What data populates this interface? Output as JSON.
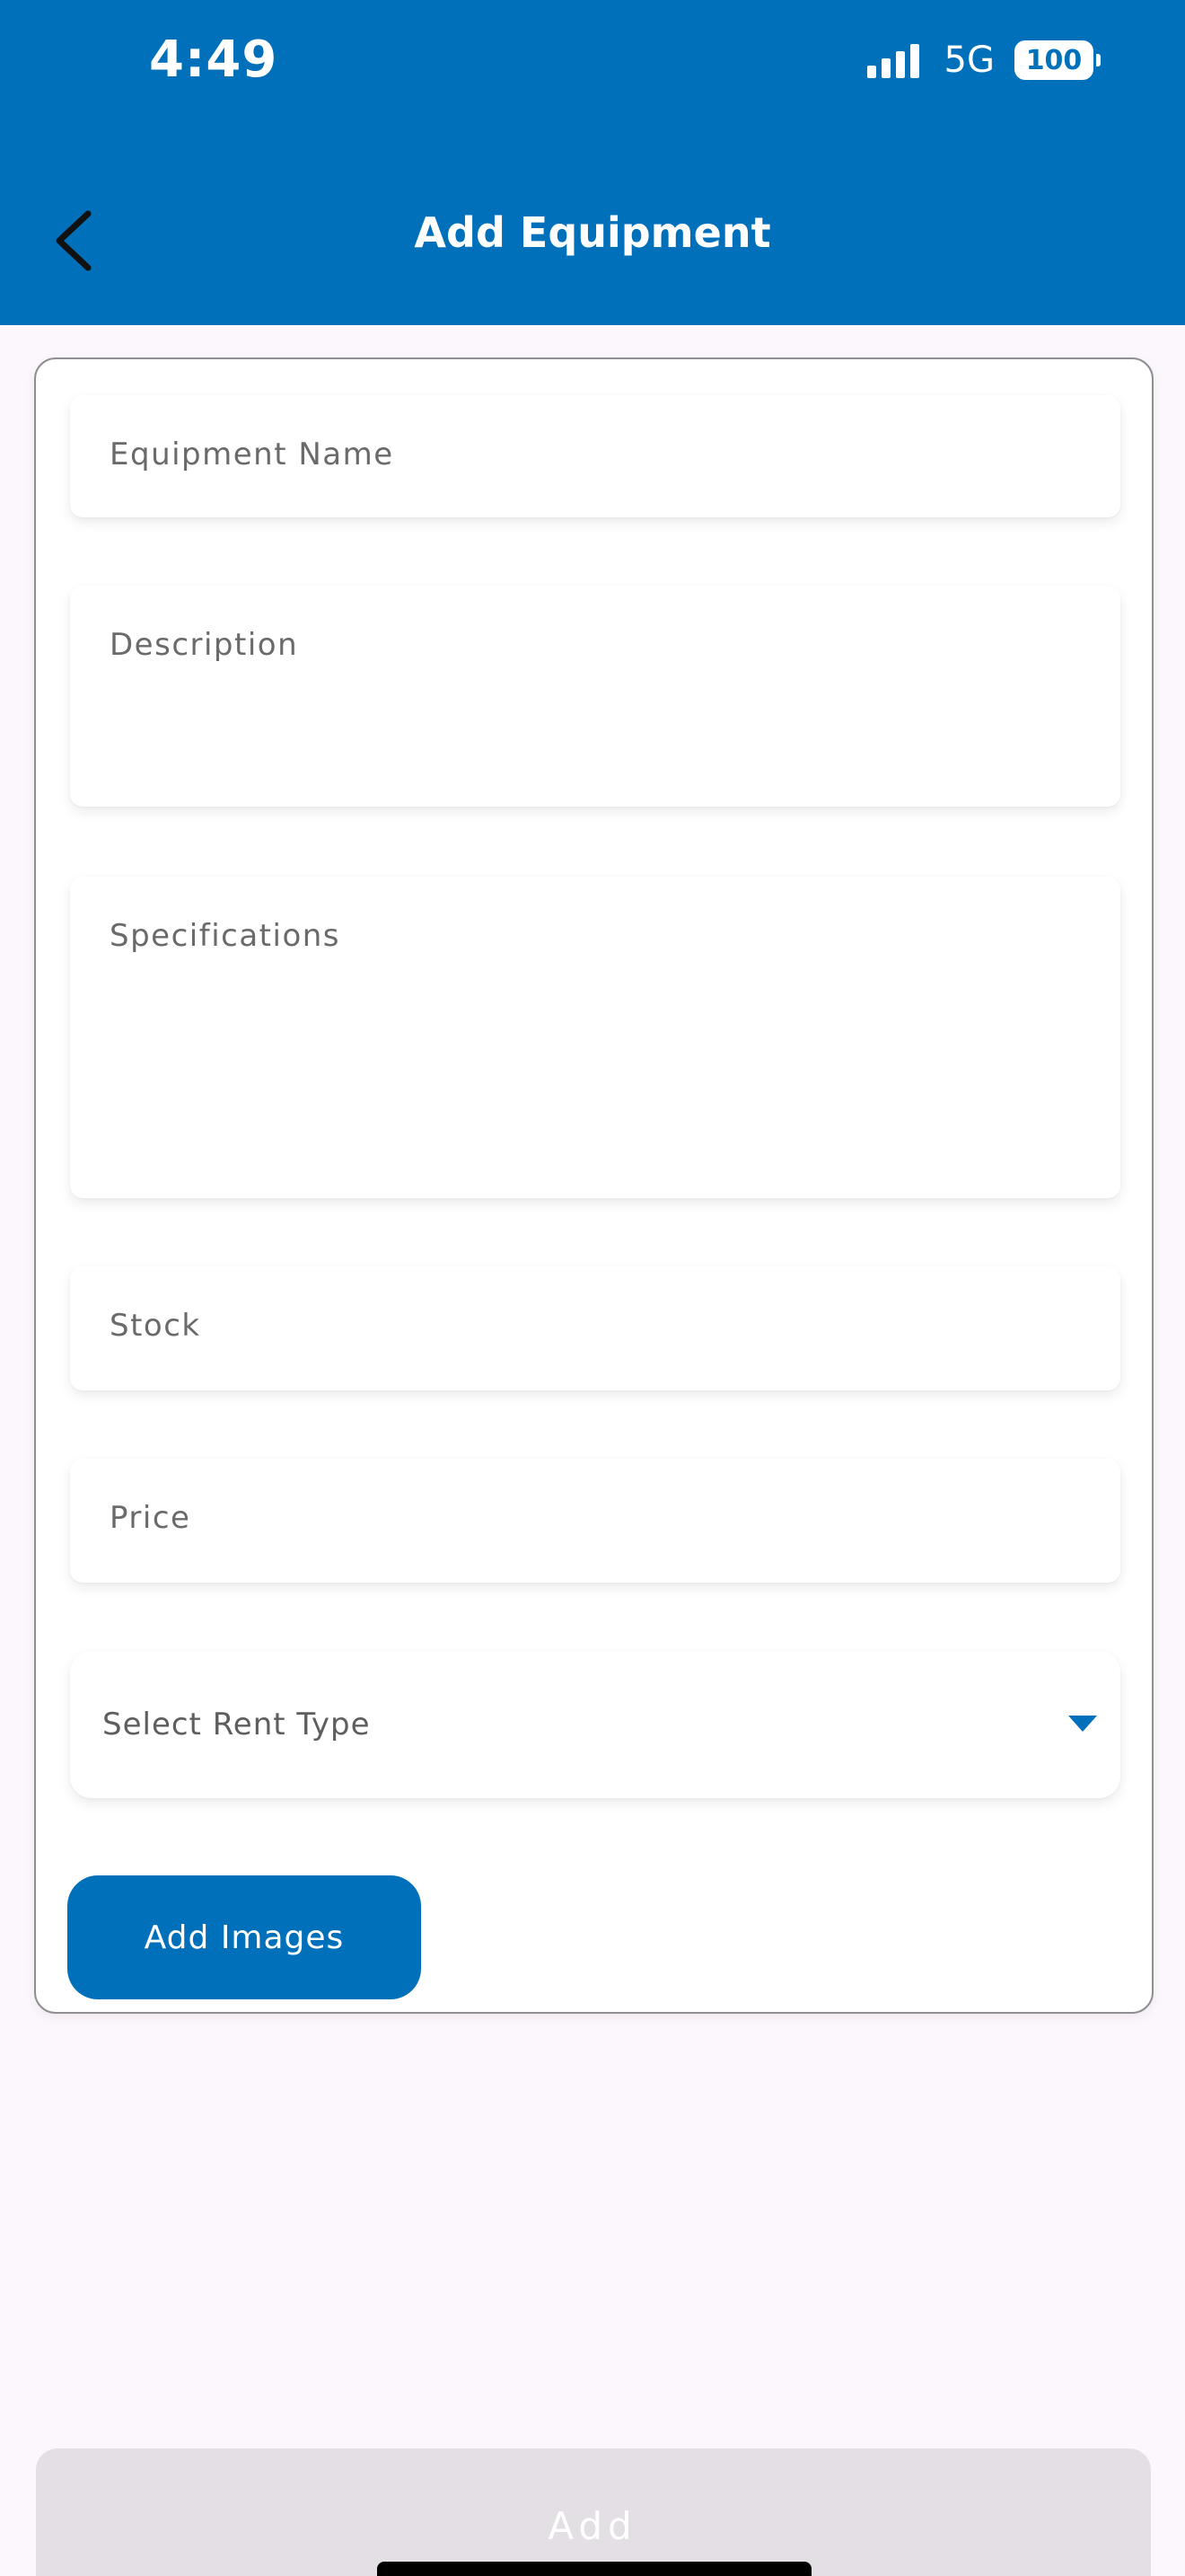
{
  "status_bar": {
    "time": "4:49",
    "network": "5G",
    "battery": "100"
  },
  "header": {
    "title": "Add Equipment",
    "background_color": "#0170ba"
  },
  "form": {
    "equipment_name_placeholder": "Equipment Name",
    "description_placeholder": "Description",
    "specifications_placeholder": "Specifications",
    "stock_placeholder": "Stock",
    "price_placeholder": "Price",
    "rent_type_select": "Select Rent Type",
    "add_images_label": "Add Images"
  },
  "footer": {
    "add_label": "Add"
  },
  "icons": {
    "back": "chevron-left-icon",
    "dropdown": "caret-down-icon",
    "signal": "signal-bars-icon",
    "battery": "battery-icon"
  }
}
